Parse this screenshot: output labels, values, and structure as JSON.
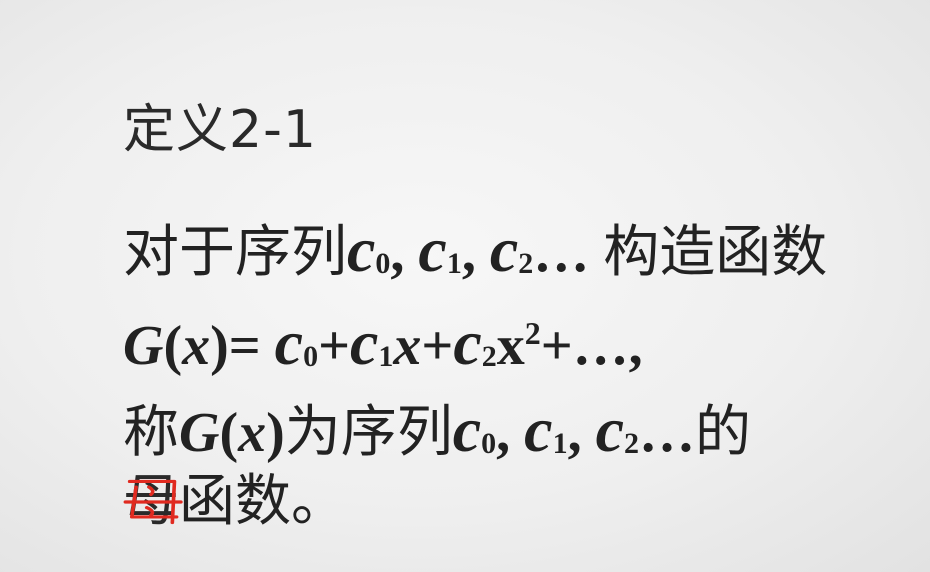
{
  "slide": {
    "title": "定义2-1",
    "line1": {
      "prefix": "对于序列",
      "c0": "c",
      "c0_sub": "0",
      "sep1": ", ",
      "c1": "c",
      "c1_sub": "1",
      "sep2": ", ",
      "c2": "c",
      "c2_sub": "2",
      "ellipsis": "… ",
      "suffix": "构造函数"
    },
    "line2": {
      "G": "G",
      "open": "(",
      "x": "x",
      "close_eq": ")= ",
      "c0": "c",
      "c0_sub": "0",
      "plus1": "+",
      "c1": "c",
      "c1_sub": "1",
      "x1": "x",
      "plus2": "+",
      "c2": "c",
      "c2_sub": "2",
      "x2": "x",
      "x2_sup": "2",
      "tail": "+…,"
    },
    "line3": {
      "prefix": "称",
      "G": "G",
      "open": "(",
      "x": "x",
      "close": ")",
      "middle": "为序列",
      "c0": "c",
      "c0_sub": "0",
      "sep1": ", ",
      "c1": "c",
      "c1_sub": "1",
      "sep2": ", ",
      "c2": "c",
      "c2_sub": "2",
      "ellipsis": "…",
      "suffix": "的"
    },
    "line4": {
      "marked_char": "母",
      "rest": "函数。"
    },
    "annotation_color": "#e02a20"
  }
}
